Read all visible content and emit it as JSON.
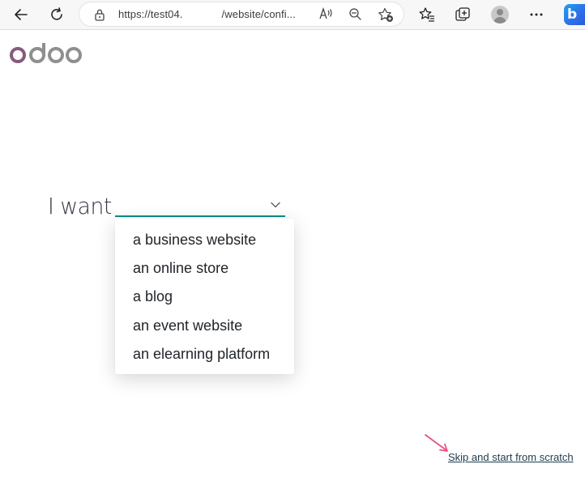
{
  "browser": {
    "url_prefix": "https://test04.",
    "url_suffix": "/website/confi..."
  },
  "app": {
    "logo_text": "odoo",
    "logo_colors": [
      "#875a7b",
      "#8f8f8f"
    ]
  },
  "configurator": {
    "prompt": "I want",
    "selected_value": "",
    "options": [
      "a business website",
      "an online store",
      "a blog",
      "an event website",
      "an elearning platform"
    ]
  },
  "footer": {
    "skip_link": "Skip and start from scratch"
  },
  "colors": {
    "accent": "#0e8a8a",
    "annotation_arrow": "#e8508a",
    "link": "#1f3b4d"
  }
}
